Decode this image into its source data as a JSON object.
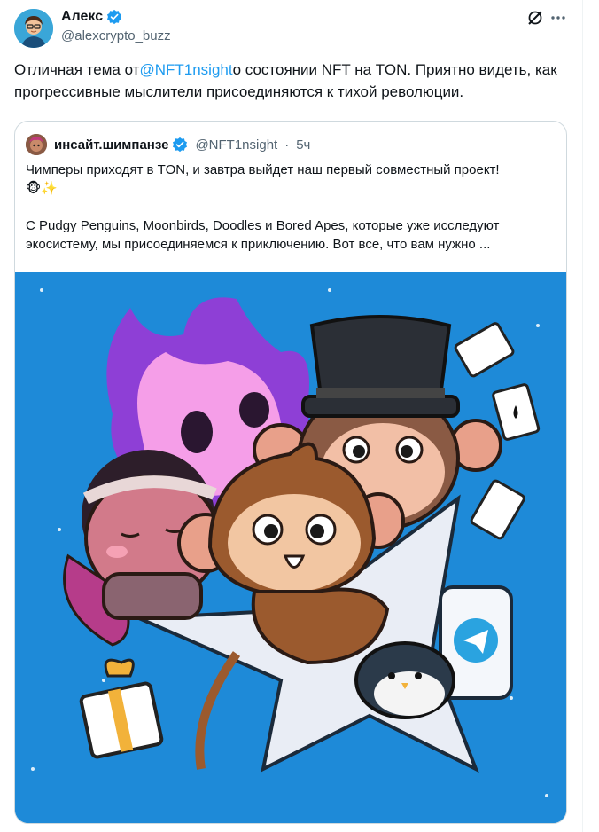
{
  "author": {
    "display_name": "Алекс",
    "handle": "@alexcrypto_buzz"
  },
  "tweet": {
    "text_before": "Отличная тема от",
    "mention": "@NFT1nsight",
    "text_after": "о состоянии NFT на TON. Приятно видеть, как прогрессивные мыслители присоединяются к тихой революции."
  },
  "quoted": {
    "display_name": "инсайт.шимпанзе",
    "handle": "@NFT1nsight",
    "separator": "·",
    "time": "5ч",
    "line1": "Чимперы приходят в TON, и завтра выйдет наш первый совместный проект!",
    "line2": "🐵✨",
    "line3": "",
    "line4": "С Pudgy Penguins, Moonbirds, Doodles и Bored Apes, которые уже исследуют экосистему, мы присоединяемся к приключению. Вот все, что вам нужно ..."
  },
  "colors": {
    "accent": "#1d9bf0",
    "text": "#0f1419",
    "secondary": "#536471",
    "border": "#cfd9de",
    "image_bg": "#1e8ad8"
  },
  "icons": {
    "verified": "verified-badge-icon",
    "grok": "grok-icon",
    "more": "more-icon"
  }
}
